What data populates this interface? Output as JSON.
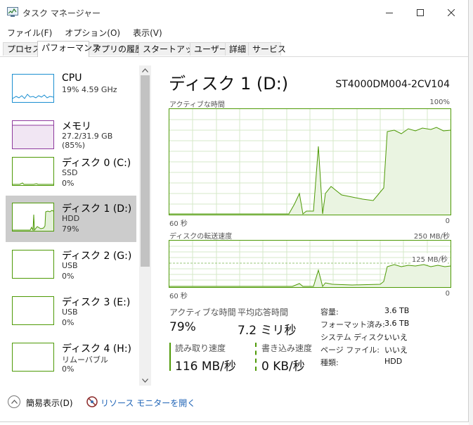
{
  "window": {
    "title": "タスク マネージャー"
  },
  "menu": [
    "ファイル(F)",
    "オプション(O)",
    "表示(V)"
  ],
  "tabs": [
    "プロセス",
    "パフォーマンス",
    "アプリの履歴",
    "スタートアップ",
    "ユーザー",
    "詳細",
    "サービス"
  ],
  "active_tab": "パフォーマンス",
  "sidebar": {
    "items": [
      {
        "name": "CPU",
        "sub1": "19%  4.59 GHz",
        "color": "#1c8fd1"
      },
      {
        "name": "メモリ",
        "sub1": "27.2/31.9 GB (85%)",
        "color": "#8e3a9d"
      },
      {
        "name": "ディスク 0 (C:)",
        "sub1": "SSD",
        "sub2": "0%",
        "color": "#4e9a06"
      },
      {
        "name": "ディスク 1 (D:)",
        "sub1": "HDD",
        "sub2": "79%",
        "color": "#4e9a06",
        "selected": true
      },
      {
        "name": "ディスク 2 (G:)",
        "sub1": "USB",
        "sub2": "0%",
        "color": "#4e9a06"
      },
      {
        "name": "ディスク 3 (E:)",
        "sub1": "USB",
        "sub2": "0%",
        "color": "#4e9a06"
      },
      {
        "name": "ディスク 4 (H:)",
        "sub1": "リムーバブル",
        "sub2": "0%",
        "color": "#4e9a06"
      }
    ]
  },
  "main": {
    "title": "ディスク 1 (D:)",
    "model": "ST4000DM004-2CV104",
    "active_graph": {
      "label": "アクティブな時間",
      "max": "100%",
      "x_left": "60 秒",
      "x_right": "0"
    },
    "transfer_graph": {
      "label": "ディスクの転送速度",
      "max": "250 MB/秒",
      "mid": "125 MB/秒",
      "x_left": "60 秒",
      "x_right": "0"
    },
    "stats": {
      "active_time_label": "アクティブな時間",
      "active_time": "79%",
      "avg_response_label": "平均応答時間",
      "avg_response": "7.2 ミリ秒",
      "read_label": "読み取り速度",
      "read": "116 MB/秒",
      "write_label": "書き込み速度",
      "write": "0 KB/秒"
    },
    "info": [
      {
        "k": "容量:",
        "v": "3.6 TB"
      },
      {
        "k": "フォーマット済み:",
        "v": "3.6 TB"
      },
      {
        "k": "システム ディスク:",
        "v": "いいえ"
      },
      {
        "k": "ページ ファイル:",
        "v": "いいえ"
      },
      {
        "k": "種類:",
        "v": "HDD"
      }
    ]
  },
  "footer": {
    "fewer_details": "簡易表示(D)",
    "resource_monitor": "リソース モニターを開く"
  },
  "accent_color": "#4e9a06"
}
